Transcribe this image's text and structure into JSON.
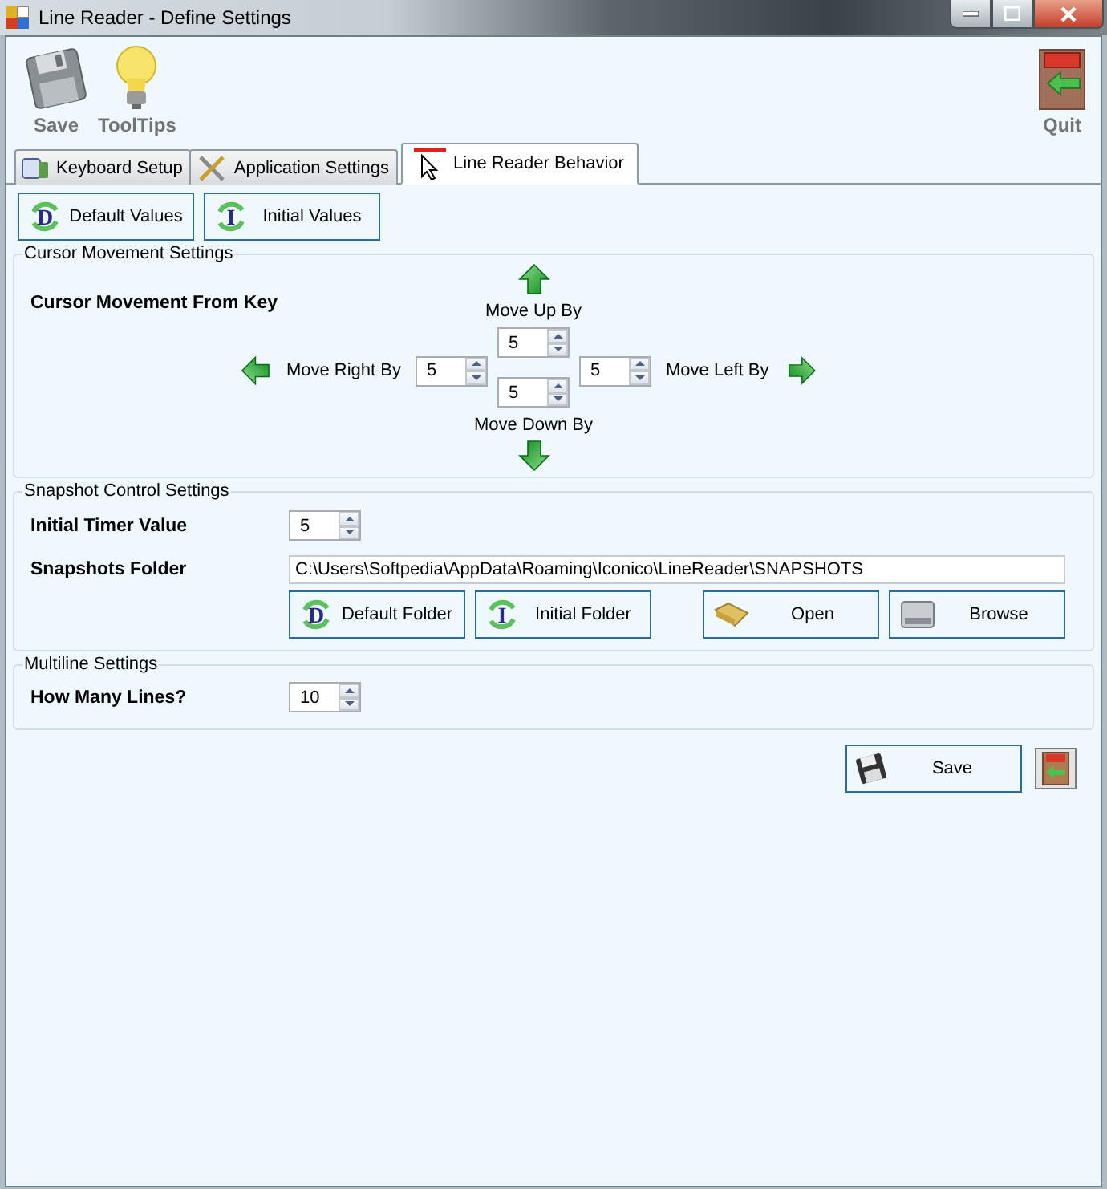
{
  "window": {
    "title": "Line Reader - Define Settings"
  },
  "toolbar": {
    "items": [
      {
        "label": "Save"
      },
      {
        "label": "ToolTips"
      },
      {
        "label": "Quit"
      }
    ]
  },
  "tabs": [
    {
      "label": "Keyboard Setup",
      "selected": false
    },
    {
      "label": "Application Settings",
      "selected": false
    },
    {
      "label": "Line Reader Behavior",
      "selected": true
    }
  ],
  "top_buttons": [
    {
      "label": "Default Values",
      "letter": "D"
    },
    {
      "label": "Initial Values",
      "letter": "I"
    }
  ],
  "cursor_movement": {
    "title": "Cursor Movement Settings",
    "heading": "Cursor Movement From Key",
    "up": {
      "label": "Move Up By",
      "value": "5"
    },
    "right": {
      "label": "Move Right By",
      "value": "5"
    },
    "left": {
      "label": "Move Left By",
      "value": "5"
    },
    "down": {
      "label": "Move Down By",
      "value": "5"
    }
  },
  "snapshot": {
    "title": "Snapshot Control Settings",
    "timer": {
      "label": "Initial Timer Value",
      "value": "5"
    },
    "folder": {
      "label": "Snapshots Folder",
      "value": "C:\\Users\\Softpedia\\AppData\\Roaming\\Iconico\\LineReader\\SNAPSHOTS"
    },
    "buttons": [
      {
        "label": "Default Folder",
        "letter": "D"
      },
      {
        "label": "Initial Folder",
        "letter": "I"
      },
      {
        "label": "Open"
      },
      {
        "label": "Browse"
      }
    ]
  },
  "multiline": {
    "title": "Multiline Settings",
    "lines": {
      "label": "How Many Lines?",
      "value": "10"
    }
  },
  "footer": {
    "save": {
      "label": "Save"
    }
  }
}
